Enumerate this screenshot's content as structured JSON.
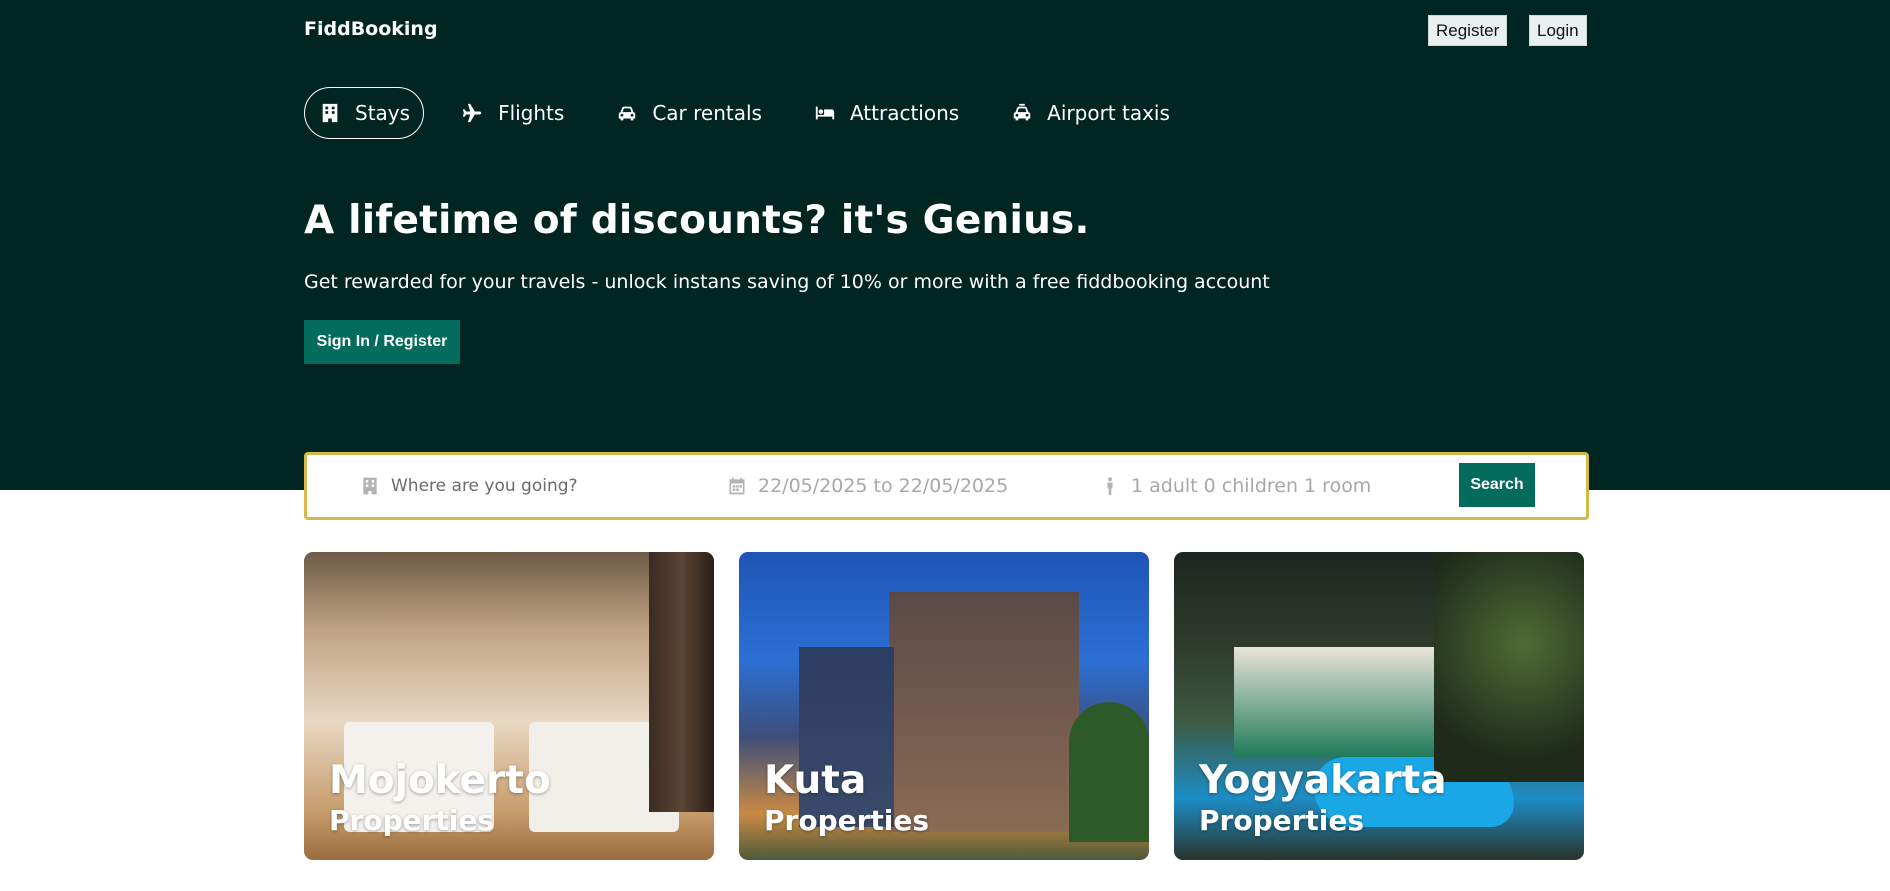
{
  "header": {
    "brand": "FiddBooking",
    "register_label": "Register",
    "login_label": "Login"
  },
  "nav": {
    "items": [
      {
        "label": "Stays",
        "icon": "building-icon",
        "active": true
      },
      {
        "label": "Flights",
        "icon": "plane-icon",
        "active": false
      },
      {
        "label": "Car rentals",
        "icon": "car-icon",
        "active": false
      },
      {
        "label": "Attractions",
        "icon": "bed-icon",
        "active": false
      },
      {
        "label": "Airport taxis",
        "icon": "taxi-icon",
        "active": false
      }
    ]
  },
  "hero": {
    "headline": "A lifetime of discounts? it's Genius.",
    "subtitle": "Get rewarded for your travels - unlock instans saving of 10% or more with a free fiddbooking account",
    "cta_label": "Sign In / Register"
  },
  "search": {
    "destination_placeholder": "Where are you going?",
    "dates_text": "22/05/2025 to 22/05/2025",
    "guests_text": "1 adult 0 children 1 room",
    "button_label": "Search",
    "border_color": "#d5b84a"
  },
  "cards": [
    {
      "title": "Mojokerto",
      "subtitle": "Properties"
    },
    {
      "title": "Kuta",
      "subtitle": "Properties"
    },
    {
      "title": "Yogyakarta",
      "subtitle": "Properties"
    }
  ],
  "colors": {
    "hero_bg": "#012520",
    "accent": "#046c5c"
  }
}
